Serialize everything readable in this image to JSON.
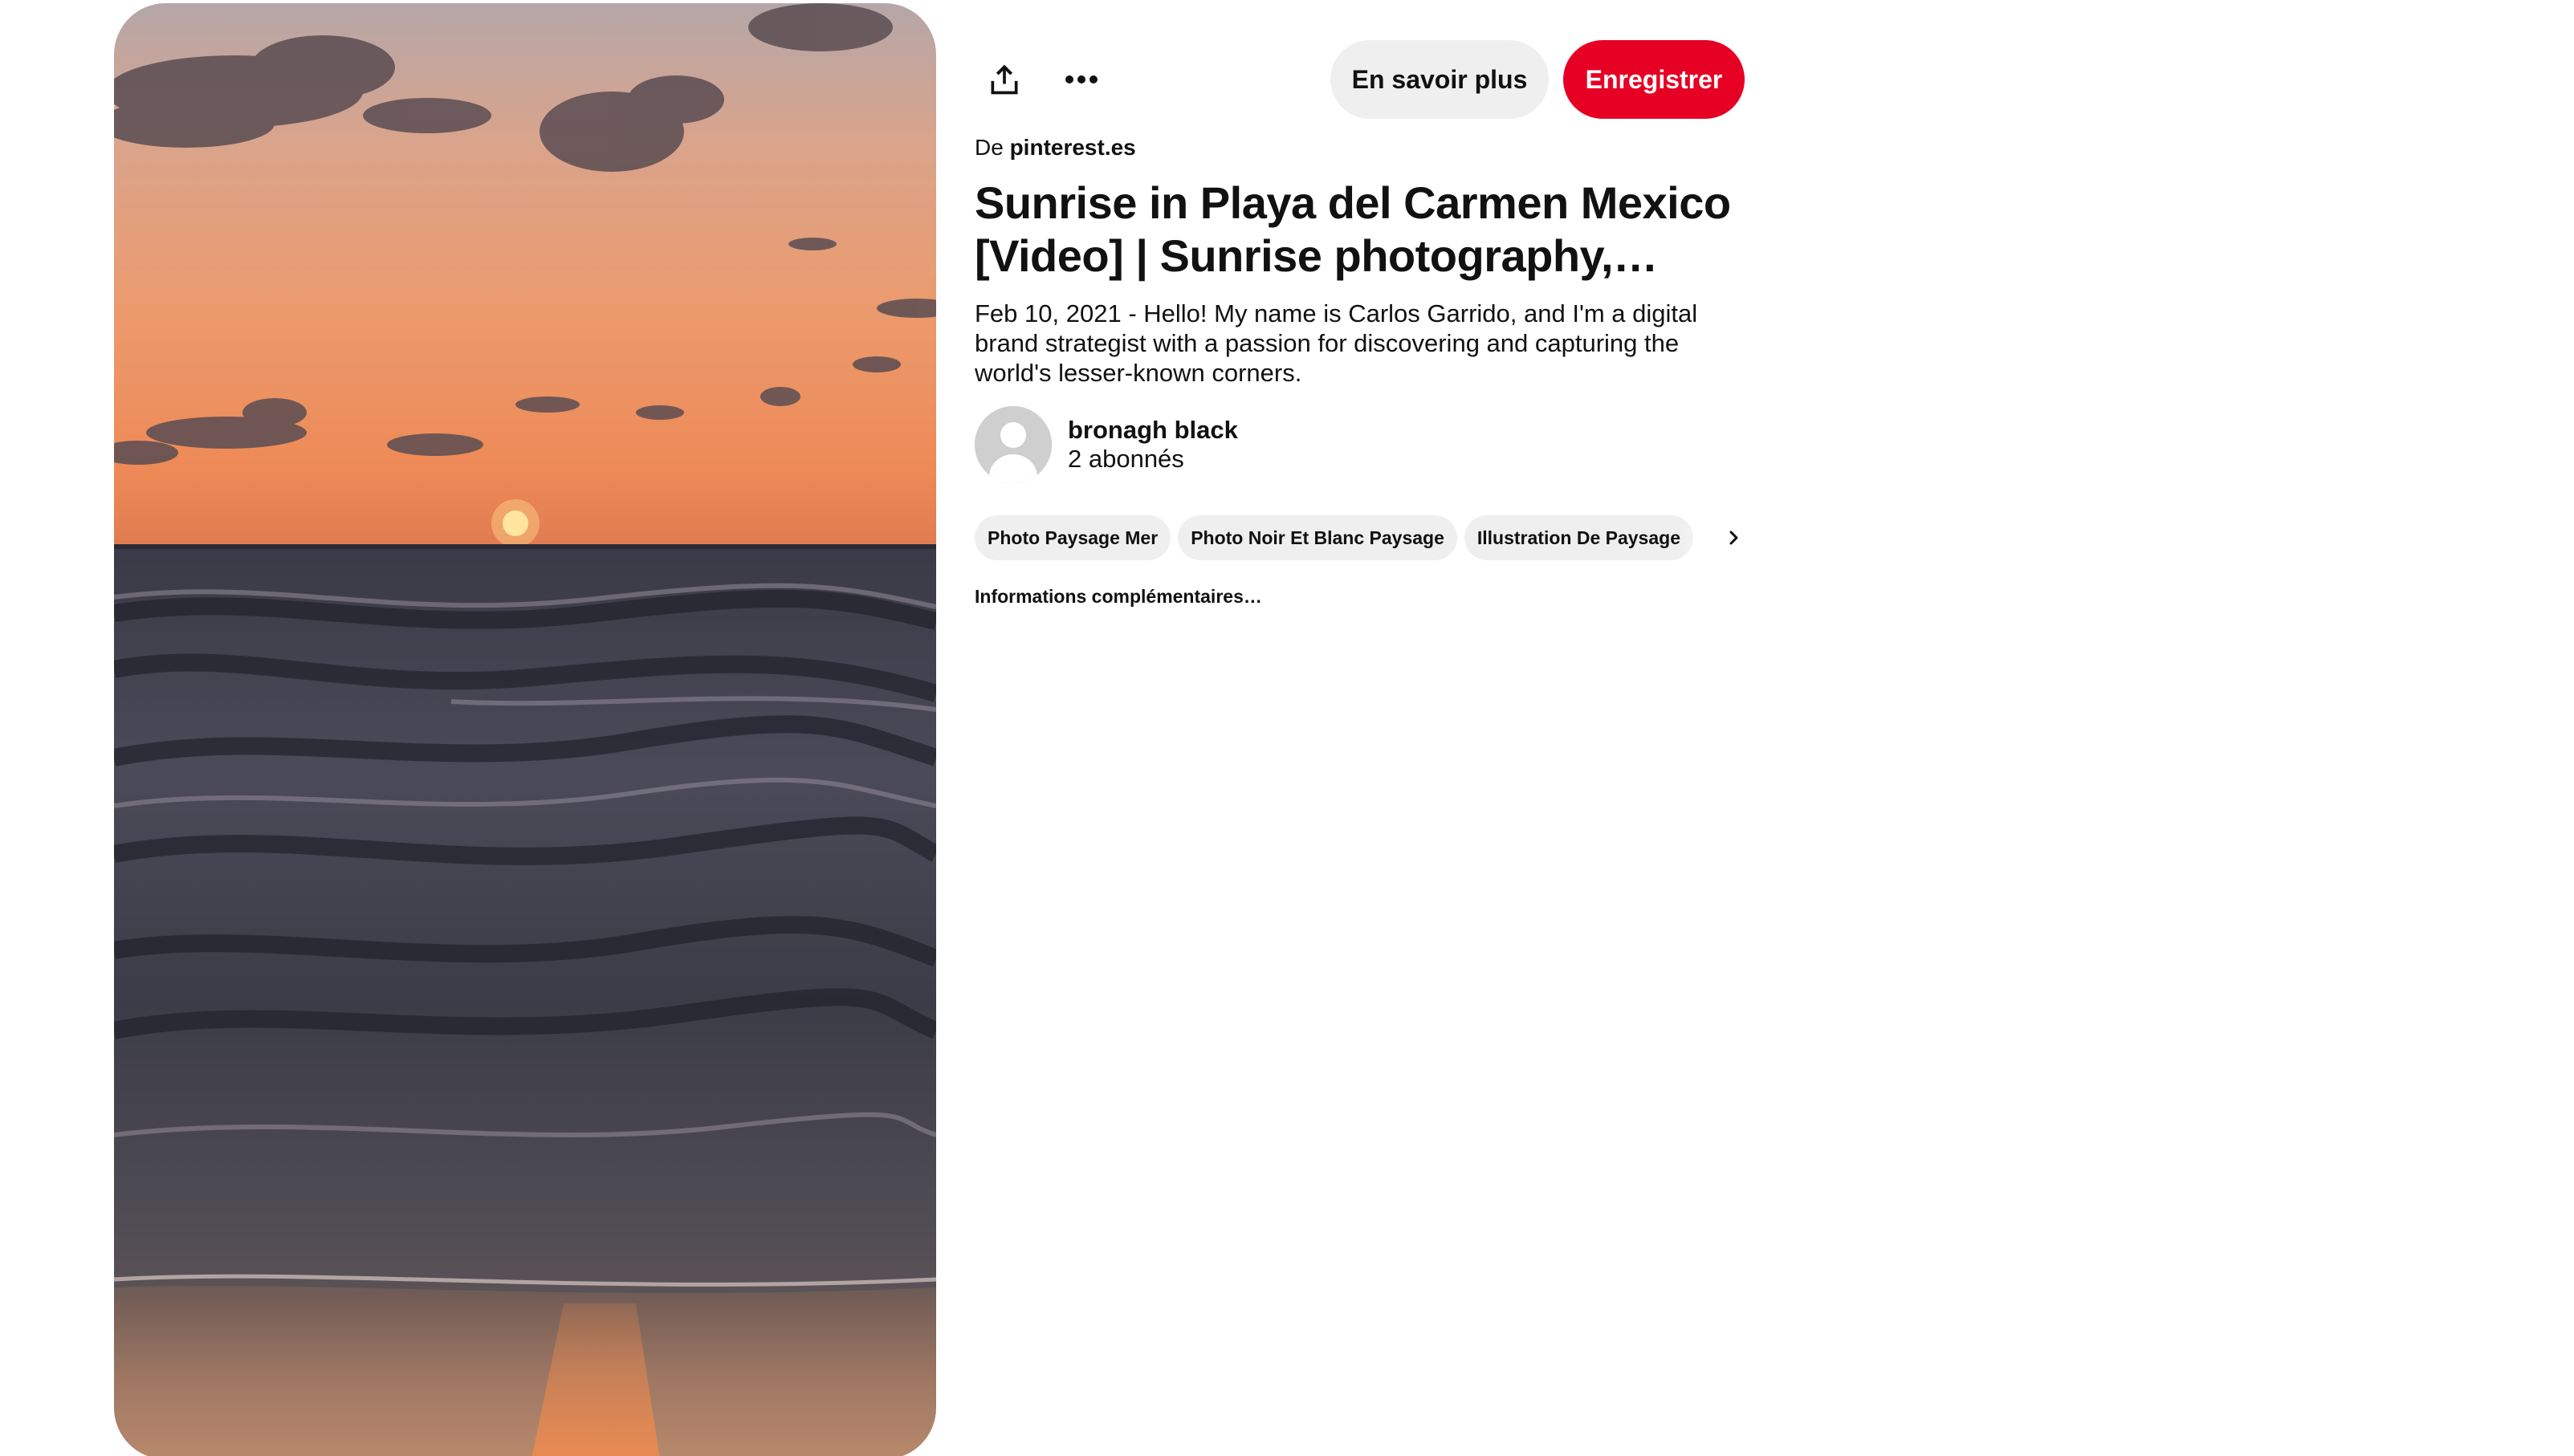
{
  "pin": {
    "image_description_icon": "sunset-beach-photo"
  },
  "toolbar": {
    "share_icon": "share-upload-icon",
    "more_icon": "ellipsis-icon",
    "learn_more_label": "En savoir plus",
    "save_label": "Enregistrer"
  },
  "source": {
    "prefix": "De",
    "domain": "pinterest.es"
  },
  "title": "Sunrise in Playa del Carmen Mexico [Video] | Sunrise photography,…",
  "description": "Feb 10, 2021 - Hello! My name is Carlos Garrido, and I'm a digital brand strategist with a passion for discovering and capturing the world's lesser-known corners.",
  "creator": {
    "name": "bronagh black",
    "followers": "2 abonnés"
  },
  "tags": [
    {
      "label": "Photo Paysage Mer"
    },
    {
      "label": "Photo Noir Et Blanc Paysage"
    },
    {
      "label": "Illustration De Paysage"
    }
  ],
  "more_info_label": "Informations complémentaires…",
  "colors": {
    "save_red": "#e60023",
    "pill_gray": "#efefef",
    "text": "#111111"
  }
}
